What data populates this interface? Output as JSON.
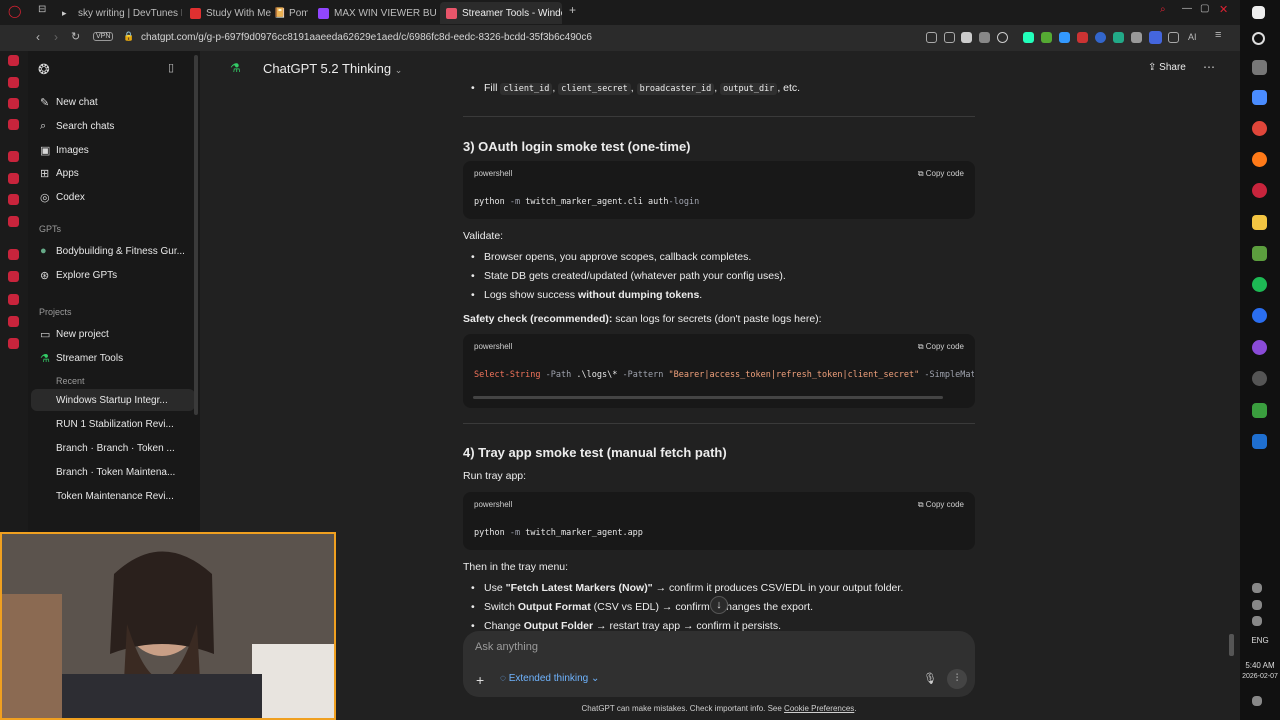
{
  "browser": {
    "tabs": [
      {
        "title": "sky writing | DevTunes FM",
        "color": "#6a6a6a"
      },
      {
        "title": "Study With Me 📔 Pom",
        "color": "#e03030"
      },
      {
        "title": "MAX WIN VIEWER BUY -",
        "color": "#9146ff"
      },
      {
        "title": "Streamer Tools - Window",
        "color": "#e8556a"
      }
    ],
    "new_tab": "+",
    "vpn": "VPN",
    "url": "chatgpt.com/g/g-p-697f9d0976cc8191aaeeda62629e1aed/c/6986fc8d-eedc-8326-bcdd-35f3b6c490c6",
    "ai_label": "AI"
  },
  "sidebar": {
    "top_items": [
      {
        "label": "New chat",
        "icon": "✎"
      },
      {
        "label": "Search chats",
        "icon": "⌕"
      },
      {
        "label": "Images",
        "icon": "▣"
      },
      {
        "label": "Apps",
        "icon": "⊞"
      },
      {
        "label": "Codex",
        "icon": "◎"
      }
    ],
    "gpts_heading": "GPTs",
    "gpts": [
      {
        "label": "Bodybuilding & Fitness Gur...",
        "icon": "●"
      },
      {
        "label": "Explore GPTs",
        "icon": "⊛"
      }
    ],
    "projects_heading": "Projects",
    "projects": [
      {
        "label": "New project",
        "icon": "▭"
      },
      {
        "label": "Streamer Tools",
        "icon": "⚗"
      }
    ],
    "recent_heading": "Recent",
    "recent": [
      "Windows Startup Integr...",
      "RUN 1 Stabilization Revi...",
      "Branch · Branch · Token ...",
      "Branch · Token Maintena...",
      "Token Maintenance Revi..."
    ]
  },
  "header": {
    "model": "ChatGPT 5.2 Thinking",
    "share": "Share"
  },
  "content": {
    "fill_line": {
      "prefix": "Fill",
      "codes": [
        "client_id",
        "client_secret",
        "broadcaster_id",
        "output_dir"
      ],
      "suffix": ", etc."
    },
    "section3": {
      "title": "3) OAuth login smoke test (one-time)",
      "code_lang": "powershell",
      "copy": "Copy code",
      "code": {
        "cmd": "python",
        "flag": "-m",
        "mod": "twitch_marker_agent.cli auth",
        "arg": "-login"
      },
      "validate": "Validate:",
      "bullets": [
        "Browser opens, you approve scopes, callback completes.",
        "State DB gets created/updated (whatever path your config uses)."
      ],
      "bullet3_prefix": "Logs show success ",
      "bullet3_bold": "without dumping tokens",
      "bullet3_suffix": ".",
      "safety_bold": "Safety check (recommended):",
      "safety_rest": " scan logs for secrets (don't paste logs here):",
      "code2_lang": "powershell",
      "code2": {
        "cmd": "Select-String",
        "p1": "-Path",
        "path": ".\\logs\\*",
        "p2": "-Pattern",
        "pattern": "\"Bearer|access_token|refresh_token|client_secret\"",
        "p3": "-SimpleMat"
      }
    },
    "section4": {
      "title": "4) Tray app smoke test (manual fetch path)",
      "run": "Run tray app:",
      "code_lang": "powershell",
      "copy": "Copy code",
      "code": {
        "cmd": "python",
        "flag": "-m",
        "mod": "twitch_marker_agent.app"
      },
      "then": "Then in the tray menu:",
      "b1_pre": "Use ",
      "b1_bold": "\"Fetch Latest Markers (Now)\"",
      "b1_rest": " → confirm it produces CSV/EDL in your output folder.",
      "b2_pre": "Switch ",
      "b2_bold": "Output Format",
      "b2_rest": " (CSV vs EDL) → confirm it changes the export.",
      "b3_pre": "Change ",
      "b3_bold": "Output Folder",
      "b3_rest": " → restart tray app → confirm it persists."
    }
  },
  "composer": {
    "placeholder": "Ask anything",
    "mode": "Extended thinking"
  },
  "footer": {
    "text": "ChatGPT can make mistakes. Check important info. See ",
    "link": "Cookie Preferences",
    "end": "."
  },
  "taskbar": {
    "lang": "ENG",
    "time": "5:40 AM",
    "date": "2026-02-07"
  }
}
